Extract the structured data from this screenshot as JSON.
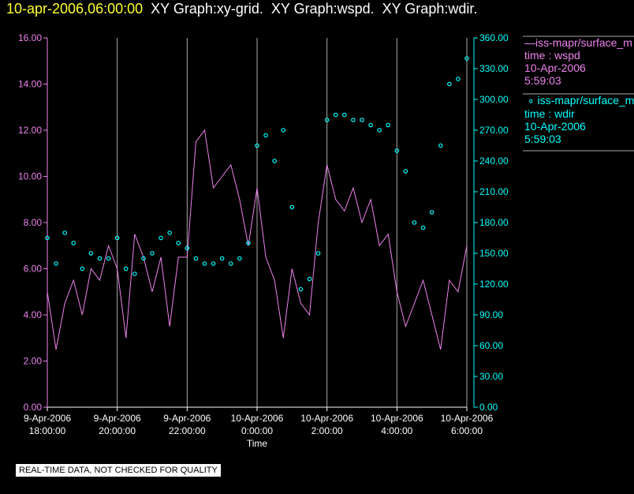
{
  "header": {
    "timestamp": "10-apr-2006,06:00:00",
    "graphs": "XY Graph:xy-grid.  XY Graph:wspd.  XY Graph:wdir."
  },
  "legend": [
    {
      "symbol": "—",
      "name": "iss-mapr/surface_m",
      "line2": "time : wspd",
      "line3": "10-Apr-2006",
      "line4": "5:59:03",
      "color": "#ee82ee"
    },
    {
      "symbol": "∘",
      "name": "iss-mapr/surface_m",
      "line2": "time : wdir",
      "line3": "10-Apr-2006",
      "line4": "5:59:03",
      "color": "#00ffff"
    }
  ],
  "note": "REAL-TIME DATA, NOT CHECKED FOR QUALITY",
  "chart_data": {
    "type": "line",
    "xlabel": "Time",
    "x_ticks": [
      [
        "9-Apr-2006",
        "18:00:00"
      ],
      [
        "9-Apr-2006",
        "20:00:00"
      ],
      [
        "9-Apr-2006",
        "22:00:00"
      ],
      [
        "10-Apr-2006",
        "0:00:00"
      ],
      [
        "10-Apr-2006",
        "2:00:00"
      ],
      [
        "10-Apr-2006",
        "4:00:00"
      ],
      [
        "10-Apr-2006",
        "6:00:00"
      ]
    ],
    "x_range_hours": [
      0,
      12
    ],
    "y_left": {
      "ticks": [
        "0.00",
        "2.00",
        "4.00",
        "6.00",
        "8.00",
        "10.00",
        "12.00",
        "14.00",
        "16.00"
      ],
      "range": [
        0,
        16
      ]
    },
    "y_right": {
      "ticks": [
        "0.00",
        "30.00",
        "60.00",
        "90.00",
        "120.00",
        "150.00",
        "180.00",
        "210.00",
        "240.00",
        "270.00",
        "300.00",
        "330.00",
        "360.00"
      ],
      "range": [
        0,
        360
      ]
    },
    "grid": "vertical",
    "x_hours_step": 0.25,
    "series": [
      {
        "name": "wspd",
        "type": "line",
        "axis": "left",
        "color": "#ee82ee",
        "values": [
          5.0,
          2.5,
          4.5,
          5.5,
          4.0,
          6.0,
          5.5,
          7.0,
          6.0,
          3.0,
          7.5,
          6.5,
          5.0,
          6.5,
          3.5,
          6.5,
          6.5,
          11.5,
          12.0,
          9.5,
          10.0,
          10.5,
          9.0,
          7.0,
          9.5,
          6.5,
          5.5,
          3.0,
          6.0,
          4.5,
          4.0,
          8.0,
          10.5,
          9.0,
          8.5,
          9.5,
          8.0,
          9.0,
          7.0,
          7.5,
          5.0,
          3.5,
          4.5,
          5.5,
          4.0,
          2.5,
          5.5,
          5.0,
          7.0
        ]
      },
      {
        "name": "wdir",
        "type": "scatter",
        "axis": "right",
        "color": "#00ffff",
        "values": [
          165,
          140,
          170,
          160,
          135,
          150,
          145,
          145,
          165,
          135,
          130,
          145,
          150,
          165,
          170,
          160,
          155,
          145,
          140,
          140,
          145,
          140,
          145,
          160,
          255,
          265,
          240,
          270,
          195,
          115,
          125,
          150,
          280,
          285,
          285,
          280,
          280,
          275,
          270,
          275,
          250,
          230,
          180,
          175,
          190,
          255,
          315,
          320,
          340
        ]
      }
    ]
  }
}
